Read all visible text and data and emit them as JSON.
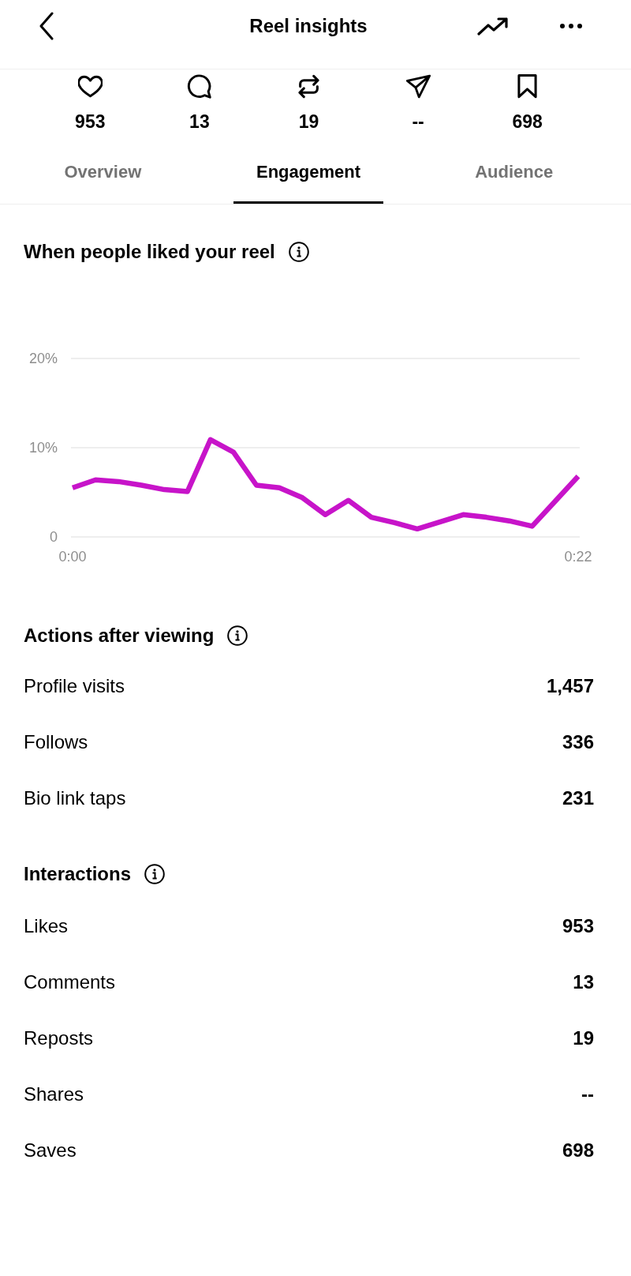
{
  "header": {
    "title": "Reel insights"
  },
  "stats": [
    {
      "kind": "likes",
      "value": "953"
    },
    {
      "kind": "comments",
      "value": "13"
    },
    {
      "kind": "reposts",
      "value": "19"
    },
    {
      "kind": "shares",
      "value": "--"
    },
    {
      "kind": "saves",
      "value": "698"
    }
  ],
  "tabs": [
    {
      "label": "Overview",
      "selected": false
    },
    {
      "label": "Engagement",
      "selected": true
    },
    {
      "label": "Audience",
      "selected": false
    }
  ],
  "likes_chart": {
    "title": "When people liked your reel",
    "chart_data": {
      "type": "line",
      "x": [
        0,
        1,
        2,
        3,
        4,
        5,
        6,
        7,
        8,
        9,
        10,
        11,
        12,
        13,
        14,
        15,
        16,
        17,
        18,
        19,
        20,
        21,
        22
      ],
      "series": [
        {
          "color": "#c714c9",
          "values": [
            5.5,
            6.4,
            6.2,
            5.8,
            5.3,
            5.1,
            10.9,
            9.5,
            5.8,
            5.5,
            4.4,
            2.5,
            4.1,
            2.2,
            1.6,
            0.9,
            1.7,
            2.5,
            2.2,
            1.8,
            1.2,
            4.0,
            6.8
          ]
        }
      ],
      "xlim": [
        0,
        22
      ],
      "ylim": [
        0,
        20
      ],
      "xticks": [
        {
          "value": 0,
          "label": "0:00"
        },
        {
          "value": 22,
          "label": "0:22"
        }
      ],
      "yticks": [
        {
          "value": 0,
          "label": "0"
        },
        {
          "value": 10,
          "label": "10%"
        },
        {
          "value": 20,
          "label": "20%"
        }
      ]
    }
  },
  "sections": [
    {
      "title": "Actions after viewing",
      "rows": [
        {
          "label": "Profile visits",
          "value": "1,457"
        },
        {
          "label": "Follows",
          "value": "336"
        },
        {
          "label": "Bio link taps",
          "value": "231"
        }
      ]
    },
    {
      "title": "Interactions",
      "rows": [
        {
          "label": "Likes",
          "value": "953"
        },
        {
          "label": "Comments",
          "value": "13"
        },
        {
          "label": "Reposts",
          "value": "19"
        },
        {
          "label": "Shares",
          "value": "--"
        },
        {
          "label": "Saves",
          "value": "698"
        }
      ]
    }
  ]
}
